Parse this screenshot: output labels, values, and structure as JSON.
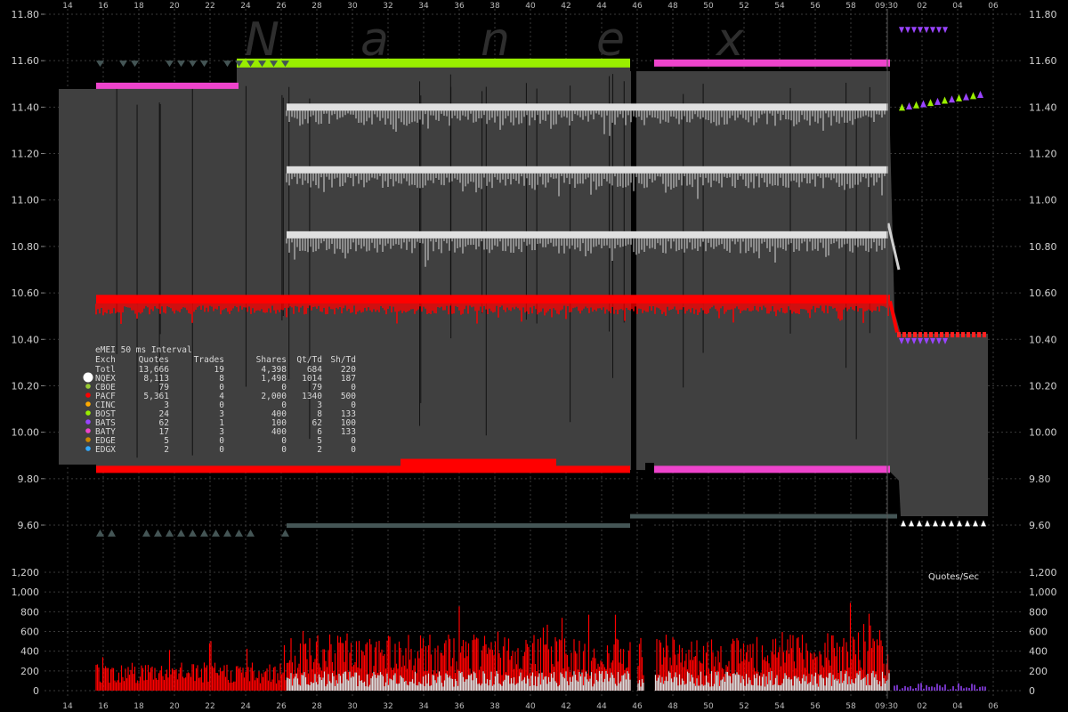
{
  "watermark": "Nanex",
  "chart_data": [
    {
      "type": "line",
      "panel": "quotes-price",
      "y_ticks": [
        "11.80",
        "11.60",
        "11.40",
        "11.20",
        "11.00",
        "10.80",
        "10.60",
        "10.40",
        "10.20",
        "10.00",
        "9.80",
        "9.60"
      ],
      "y_tick_values": [
        11.8,
        11.6,
        11.4,
        11.2,
        11.0,
        10.8,
        10.6,
        10.4,
        10.2,
        10.0,
        9.8,
        9.6
      ],
      "ylim": [
        9.5,
        11.85
      ],
      "grid": true,
      "series": [
        {
          "name": "NQEX",
          "color": "#e0e0e0",
          "points": [
            [
              0,
              11.4
            ],
            [
              0.5,
              11.4
            ],
            [
              0.85,
              11.4
            ],
            [
              0,
              11.13
            ],
            [
              0.85,
              11.13
            ],
            [
              0,
              10.85
            ],
            [
              0.85,
              10.85
            ]
          ]
        },
        {
          "name": "PACF",
          "color": "#ff0000",
          "points": [
            [
              0,
              10.58
            ],
            [
              0.85,
              10.58
            ],
            [
              0.9,
              10.42
            ],
            [
              1,
              10.42
            ]
          ]
        },
        {
          "name": "BOST",
          "color": "#99ee00",
          "points": [
            [
              0.18,
              11.59
            ],
            [
              0.56,
              11.59
            ]
          ]
        },
        {
          "name": "BATY",
          "color": "#ee44cc",
          "points": [
            [
              0,
              11.49
            ],
            [
              0.18,
              11.49
            ],
            [
              0.58,
              11.59
            ],
            [
              0.85,
              11.59
            ],
            [
              0.58,
              9.84
            ],
            [
              0.85,
              9.84
            ]
          ]
        },
        {
          "name": "BATS",
          "color": "#9944ff",
          "points": [
            [
              0.9,
              11.73
            ],
            [
              0.95,
              11.73
            ],
            [
              0.9,
              10.39
            ],
            [
              0.95,
              10.39
            ]
          ]
        }
      ]
    },
    {
      "type": "bar",
      "panel": "quotes-per-sec",
      "label": "Quotes/Sec",
      "y_ticks": [
        "1,200",
        "1,000",
        "800",
        "600",
        "400",
        "200",
        "0"
      ],
      "y_tick_values": [
        1200,
        1000,
        800,
        600,
        400,
        200,
        0
      ],
      "ylim": [
        0,
        1200
      ],
      "series": [
        {
          "name": "PACF",
          "color": "#ff0000"
        },
        {
          "name": "NQEX",
          "color": "#e0e0e0"
        }
      ]
    }
  ],
  "x_ticks": [
    "14",
    "16",
    "18",
    "20",
    "22",
    "24",
    "26",
    "28",
    "30",
    "32",
    "34",
    "36",
    "38",
    "40",
    "42",
    "44",
    "46",
    "48",
    "50",
    "52",
    "54",
    "56",
    "58",
    "09:30",
    "02",
    "04",
    "06"
  ],
  "summary": {
    "title": "eMEI 50 ms Interval",
    "columns": [
      "Exch",
      "Quotes",
      "Trades",
      "Shares",
      "Qt/Td",
      "Sh/Td"
    ],
    "rows": [
      {
        "exch": "Totl",
        "quotes": "13,666",
        "trades": "19",
        "shares": "4,398",
        "qt_td": "684",
        "sh_td": "220",
        "color": ""
      },
      {
        "exch": "NQEX",
        "quotes": "8,113",
        "trades": "8",
        "shares": "1,498",
        "qt_td": "1014",
        "sh_td": "187",
        "color": "#ffffff"
      },
      {
        "exch": "CBOE",
        "quotes": "79",
        "trades": "0",
        "shares": "0",
        "qt_td": "79",
        "sh_td": "0",
        "color": "#99cc33"
      },
      {
        "exch": "PACF",
        "quotes": "5,361",
        "trades": "4",
        "shares": "2,000",
        "qt_td": "1340",
        "sh_td": "500",
        "color": "#ff0000"
      },
      {
        "exch": "CINC",
        "quotes": "3",
        "trades": "0",
        "shares": "0",
        "qt_td": "3",
        "sh_td": "0",
        "color": "#ffaa00"
      },
      {
        "exch": "BOST",
        "quotes": "24",
        "trades": "3",
        "shares": "400",
        "qt_td": "8",
        "sh_td": "133",
        "color": "#99ee00"
      },
      {
        "exch": "BATS",
        "quotes": "62",
        "trades": "1",
        "shares": "100",
        "qt_td": "62",
        "sh_td": "100",
        "color": "#9944ff"
      },
      {
        "exch": "BATY",
        "quotes": "17",
        "trades": "3",
        "shares": "400",
        "qt_td": "6",
        "sh_td": "133",
        "color": "#ee44cc"
      },
      {
        "exch": "EDGE",
        "quotes": "5",
        "trades": "0",
        "shares": "0",
        "qt_td": "5",
        "sh_td": "0",
        "color": "#cc8800"
      },
      {
        "exch": "EDGX",
        "quotes": "2",
        "trades": "0",
        "shares": "0",
        "qt_td": "2",
        "sh_td": "0",
        "color": "#33aaff"
      }
    ]
  }
}
